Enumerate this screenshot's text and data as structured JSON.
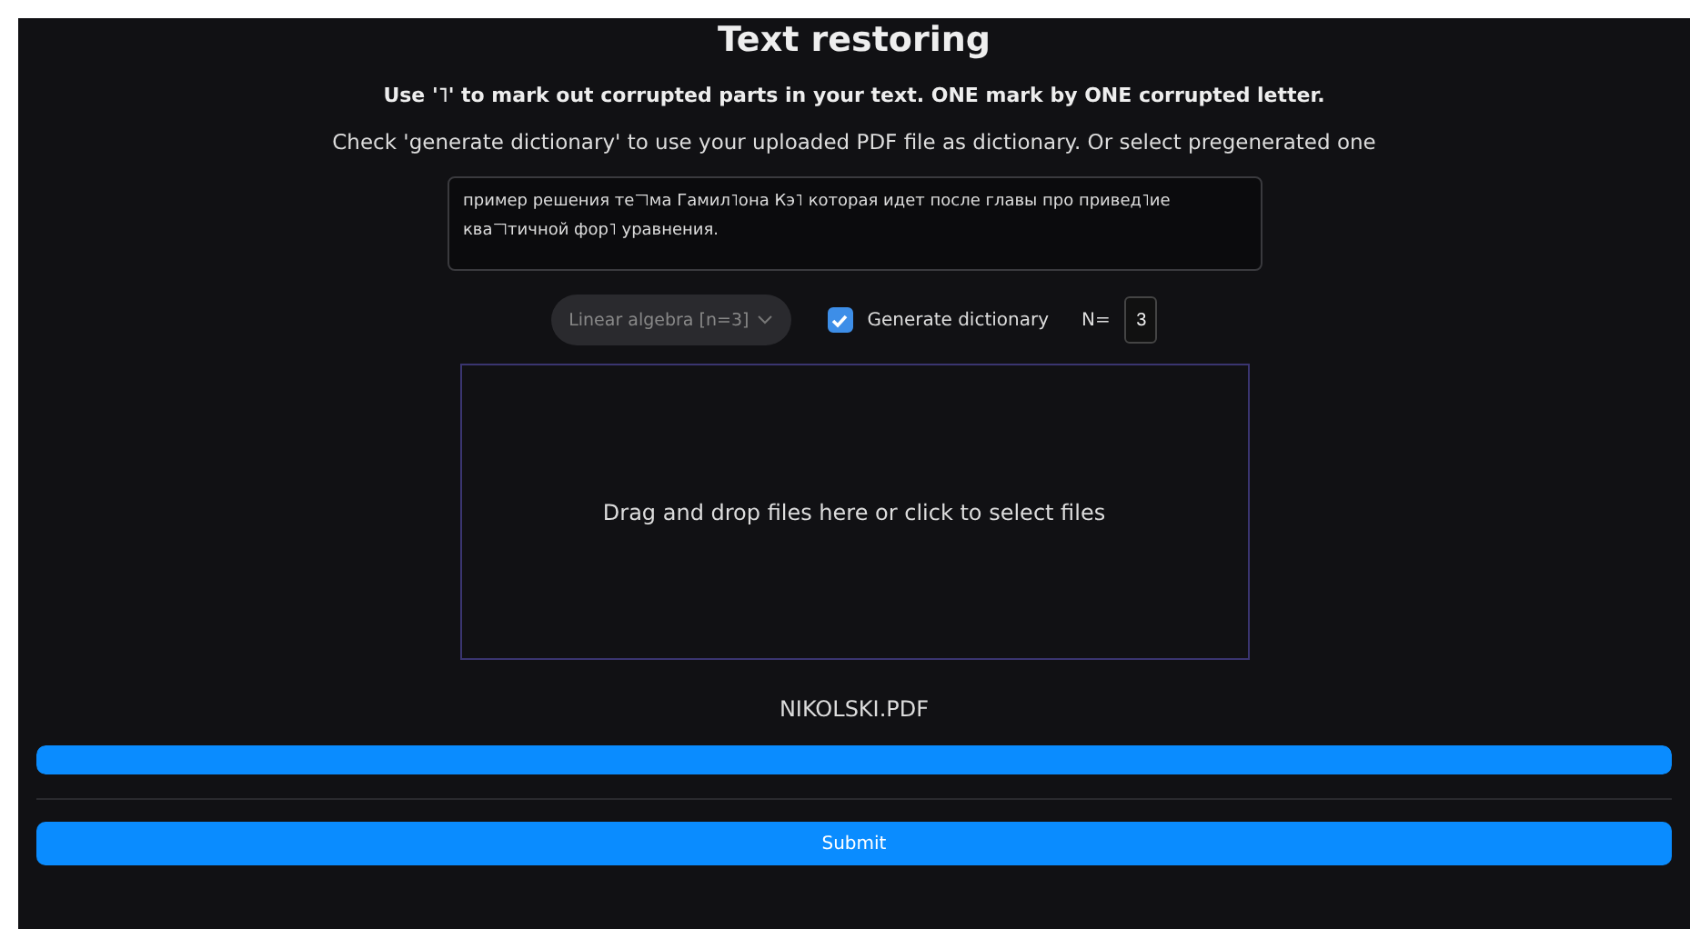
{
  "title": "Text restoring",
  "instruction": "Use '˥' to mark out corrupted parts in your text. ONE mark by ONE corrupted letter.",
  "hint": "Check 'generate dictionary' to use your uploaded PDF file as dictionary. Or select pregenerated one",
  "text_input": {
    "value": "пример решения те˥˥˥ма Гамил˥она Кэ˥ которая идет после главы про привед˥ие ква˥˥˥тичной фор˥ уравнения."
  },
  "dictionary_select": {
    "value": "Linear algebra [n=3]",
    "disabled": true
  },
  "generate_dictionary": {
    "label": "Generate dictionary",
    "checked": true
  },
  "n_field": {
    "label": "N=",
    "value": "3"
  },
  "dropzone": {
    "text": "Drag and drop files here or click to select files"
  },
  "file_name": "NIKOLSKI.PDF",
  "upload_progress": {
    "level": 1
  },
  "submit": {
    "label": "Submit"
  }
}
